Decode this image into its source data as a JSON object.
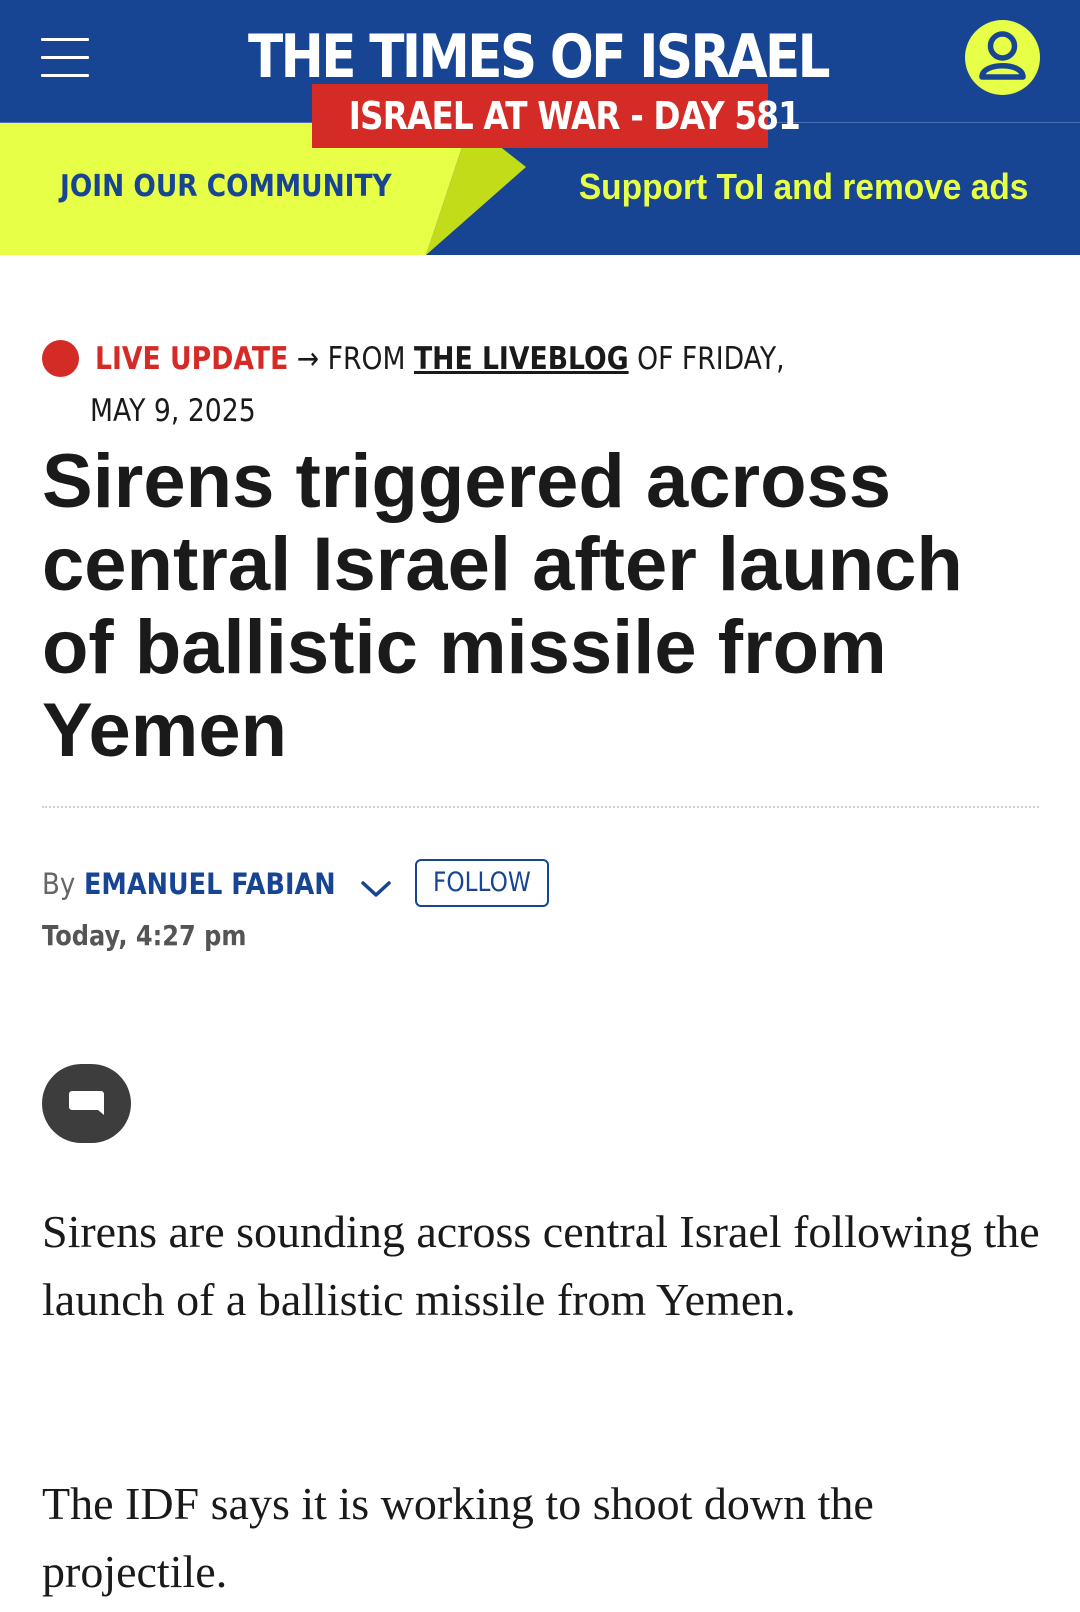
{
  "header": {
    "logo_text": "THE TIMES OF ISRAEL",
    "war_badge": "ISRAEL AT WAR - DAY 581",
    "menu_icon": "hamburger-menu-icon",
    "account_icon": "user-account-icon",
    "colors": {
      "brand_blue": "#174593",
      "accent_yellow": "#e7ff47",
      "alert_red": "#d52b27"
    }
  },
  "promo": {
    "join_label": "JOIN OUR COMMUNITY",
    "support_label": "Support ToI and remove ads"
  },
  "article": {
    "live_label": "LIVE UPDATE",
    "from_arrow": "→",
    "from_text": "FROM",
    "liveblog_link": "THE LIVEBLOG",
    "of_text": "OF FRIDAY,",
    "live_date": "MAY 9, 2025",
    "headline": "Sirens triggered across central Israel after launch of ballistic missile from Yemen",
    "by_prefix": "By",
    "author": "EMANUEL FABIAN",
    "follow_label": "FOLLOW",
    "timestamp": "Today, 4:27 pm",
    "comment_icon": "comment-bubble-icon",
    "paragraphs": [
      "Sirens are sounding across central Israel following the launch of a ballistic missile from Yemen.",
      "The IDF says it is working to shoot down the projectile."
    ]
  }
}
